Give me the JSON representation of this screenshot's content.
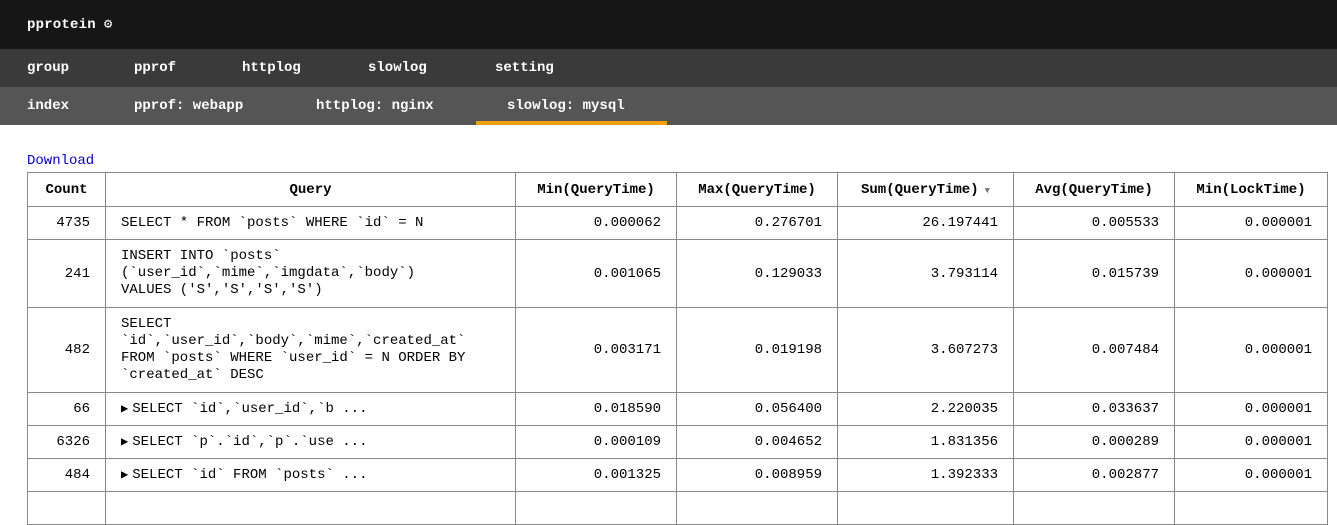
{
  "app": {
    "title": "pprotein"
  },
  "nav_primary": [
    "group",
    "pprof",
    "httplog",
    "slowlog",
    "setting"
  ],
  "nav_secondary": [
    "index",
    "pprof: webapp",
    "httplog: nginx",
    "slowlog: mysql"
  ],
  "download_label": "Download",
  "table": {
    "columns": [
      "Count",
      "Query",
      "Min(QueryTime)",
      "Max(QueryTime)",
      "Sum(QueryTime)",
      "Avg(QueryTime)",
      "Min(LockTime)"
    ],
    "sort_indicator": "▼",
    "rows": [
      {
        "count": "4735",
        "query": "SELECT * FROM `posts` WHERE `id` = N",
        "min_qt": "0.000062",
        "max_qt": "0.276701",
        "sum_qt": "26.197441",
        "avg_qt": "0.005533",
        "min_lt": "0.000001"
      },
      {
        "count": "241",
        "query": "INSERT INTO `posts`\n(`user_id`,`mime`,`imgdata`,`body`)\nVALUES ('S','S','S','S')",
        "min_qt": "0.001065",
        "max_qt": "0.129033",
        "sum_qt": "3.793114",
        "avg_qt": "0.015739",
        "min_lt": "0.000001"
      },
      {
        "count": "482",
        "query": "SELECT\n`id`,`user_id`,`body`,`mime`,`created_at`\nFROM `posts` WHERE `user_id` = N ORDER BY\n`created_at` DESC",
        "min_qt": "0.003171",
        "max_qt": "0.019198",
        "sum_qt": "3.607273",
        "avg_qt": "0.007484",
        "min_lt": "0.000001"
      },
      {
        "count": "66",
        "query": "SELECT `id`,`user_id`,`b ...",
        "collapsed": true,
        "min_qt": "0.018590",
        "max_qt": "0.056400",
        "sum_qt": "2.220035",
        "avg_qt": "0.033637",
        "min_lt": "0.000001"
      },
      {
        "count": "6326",
        "query": "SELECT `p`.`id`,`p`.`use ...",
        "collapsed": true,
        "min_qt": "0.000109",
        "max_qt": "0.004652",
        "sum_qt": "1.831356",
        "avg_qt": "0.000289",
        "min_lt": "0.000001"
      },
      {
        "count": "484",
        "query": "SELECT `id` FROM `posts` ...",
        "collapsed": true,
        "min_qt": "0.001325",
        "max_qt": "0.008959",
        "sum_qt": "1.392333",
        "avg_qt": "0.002877",
        "min_lt": "0.000001"
      }
    ]
  }
}
